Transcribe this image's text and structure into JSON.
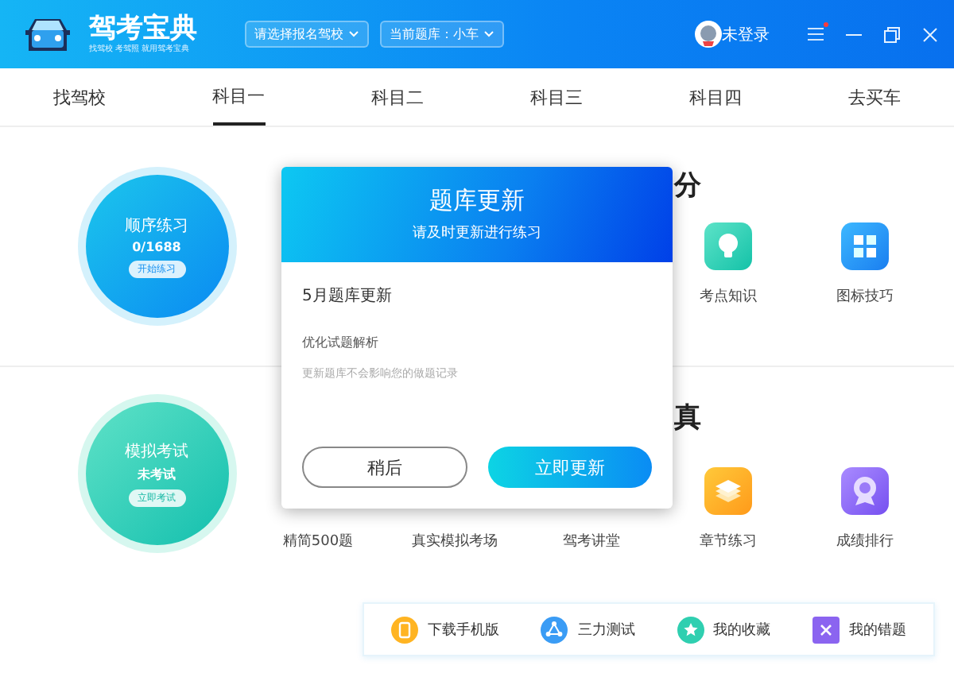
{
  "window": {
    "app_name": "驾考宝典",
    "slogan": "找驾校 考驾照 就用驾考宝典",
    "school_select": "请选择报名驾校",
    "question_bank": "当前题库：小车",
    "user": "未登录",
    "menu_badge": true
  },
  "tabs": [
    {
      "label": "找驾校",
      "selected": false
    },
    {
      "label": "科目一",
      "selected": true
    },
    {
      "label": "科目二",
      "selected": false
    },
    {
      "label": "科目三",
      "selected": false
    },
    {
      "label": "科目四",
      "selected": false
    },
    {
      "label": "去买车",
      "selected": false
    }
  ],
  "sections": [
    {
      "heading": "分",
      "circle": {
        "title": "顺序练习",
        "subtitle": "0/1688",
        "action": "开始练习",
        "kind": "practice"
      },
      "items": [
        {
          "label": "考点知识",
          "kind": "knowledge"
        },
        {
          "label": "图标技巧",
          "kind": "signs"
        }
      ]
    },
    {
      "heading": "真",
      "circle": {
        "title": "模拟考试",
        "subtitle": "未考试",
        "action": "立即考试",
        "kind": "exam"
      },
      "items": [
        {
          "label": "精简500题",
          "kind": "covered"
        },
        {
          "label": "真实模拟考场",
          "kind": "covered"
        },
        {
          "label": "驾考讲堂",
          "kind": "covered"
        },
        {
          "label": "章节练习",
          "kind": "chapters"
        },
        {
          "label": "成绩排行",
          "kind": "ranking"
        }
      ]
    }
  ],
  "dialog": {
    "title": "题库更新",
    "subtitle": "请及时更新进行练习",
    "heading": "5月题库更新",
    "note": "优化试题解析",
    "hint": "更新题库不会影响您的做题记录",
    "buttons": [
      {
        "label": "稍后",
        "kind": "secondary"
      },
      {
        "label": "立即更新",
        "kind": "primary"
      }
    ]
  },
  "bottom_bar": [
    {
      "label": "下载手机版"
    },
    {
      "label": "三力测试"
    },
    {
      "label": "我的收藏"
    },
    {
      "label": "我的错题"
    }
  ]
}
